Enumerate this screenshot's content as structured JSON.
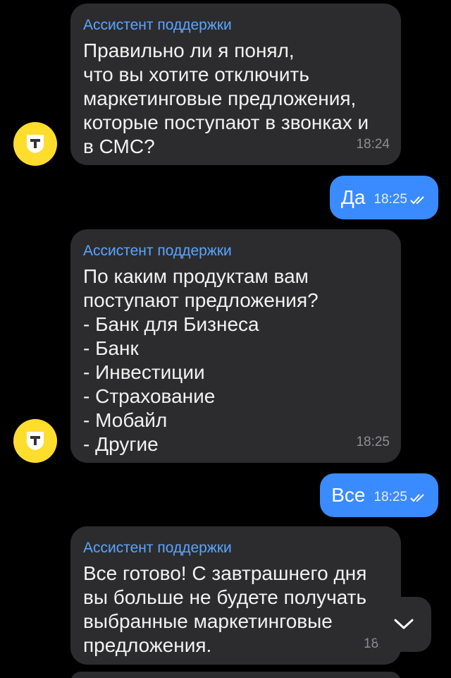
{
  "messages": [
    {
      "sender": "Ассистент поддержки",
      "text": "Правильно ли я понял,\nчто вы хотите отключить\nмаркетинговые предложения,\nкоторые поступают в звонках и\nв СМС?",
      "time": "18:24"
    },
    {
      "outgoing_text": "Да",
      "time": "18:25"
    },
    {
      "sender": "Ассистент поддержки",
      "text": "По каким продуктам вам\nпоступают предложения?\n- Банк для Бизнеса\n- Банк\n- Инвестиции\n- Страхование\n- Мобайл\n- Другие",
      "time": "18:25"
    },
    {
      "outgoing_text": "Все",
      "time": "18:25"
    },
    {
      "sender": "Ассистент поддержки",
      "text": "Все готово! С завтрашнего дня\nвы больше не будете получать\nвыбранные маркетинговые\nпредложения.",
      "time": "18:2"
    }
  ],
  "avatar": {
    "icon": "tbank-shield-icon",
    "letter": "Т",
    "color": "#ffdd2d"
  },
  "colors": {
    "background": "#000000",
    "incoming_bubble": "#2c2c2e",
    "outgoing_bubble": "#3a8bff",
    "sender_name": "#5aa5ff"
  },
  "scroll_button": {
    "icon": "chevron-down-icon"
  }
}
